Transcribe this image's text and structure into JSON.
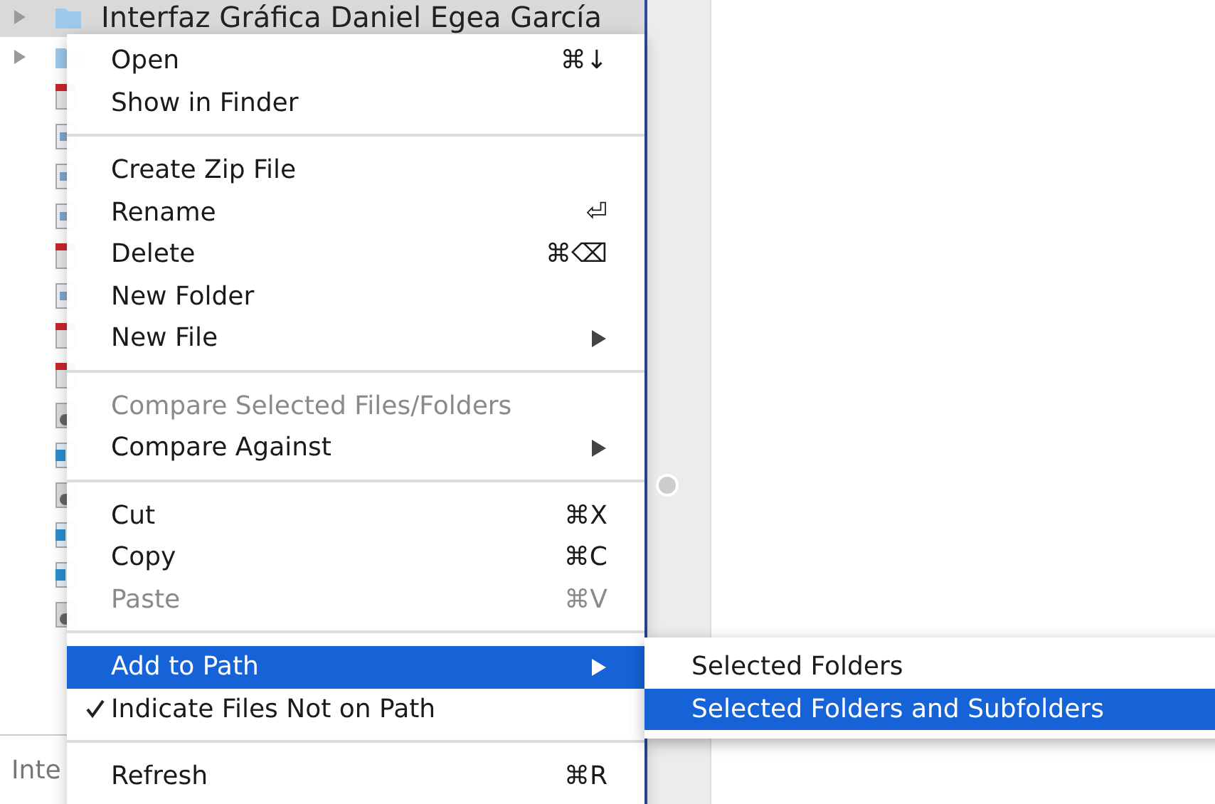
{
  "file_list": [
    {
      "kind": "folder",
      "name": "Interfaz Gráfica Daniel Egea García",
      "selected": true
    },
    {
      "kind": "folder",
      "selected": false
    },
    {
      "kind": "pdf",
      "selected": false
    },
    {
      "kind": "image",
      "selected": false
    },
    {
      "kind": "image",
      "selected": false
    },
    {
      "kind": "image",
      "selected": false
    },
    {
      "kind": "pdf",
      "selected": false
    },
    {
      "kind": "image",
      "selected": false
    },
    {
      "kind": "pdf",
      "selected": false
    },
    {
      "kind": "pdf",
      "selected": false
    },
    {
      "kind": "locked",
      "selected": false
    },
    {
      "kind": "word",
      "selected": false
    },
    {
      "kind": "locked",
      "selected": false
    },
    {
      "kind": "word",
      "selected": false
    },
    {
      "kind": "word",
      "selected": false
    },
    {
      "kind": "locked",
      "selected": false
    }
  ],
  "details_panel": {
    "title": "Inte"
  },
  "context_menu": [
    {
      "kind": "item",
      "label": "Open",
      "shortcut": "⌘↓",
      "submenu": false,
      "disabled": false,
      "checked": false,
      "selected": false
    },
    {
      "kind": "item",
      "label": "Show in Finder",
      "submenu": false,
      "disabled": false,
      "checked": false,
      "selected": false
    },
    {
      "kind": "separator"
    },
    {
      "kind": "item",
      "label": "Create Zip File",
      "submenu": false,
      "disabled": false,
      "checked": false,
      "selected": false
    },
    {
      "kind": "item",
      "label": "Rename",
      "shortcut": "⏎",
      "submenu": false,
      "disabled": false,
      "checked": false,
      "selected": false
    },
    {
      "kind": "item",
      "label": "Delete",
      "shortcut": "⌘⌫",
      "submenu": false,
      "disabled": false,
      "checked": false,
      "selected": false
    },
    {
      "kind": "item",
      "label": "New Folder",
      "submenu": false,
      "disabled": false,
      "checked": false,
      "selected": false
    },
    {
      "kind": "item",
      "label": "New File",
      "submenu": true,
      "disabled": false,
      "checked": false,
      "selected": false
    },
    {
      "kind": "separator"
    },
    {
      "kind": "item",
      "label": "Compare Selected Files/Folders",
      "submenu": false,
      "disabled": true,
      "checked": false,
      "selected": false
    },
    {
      "kind": "item",
      "label": "Compare Against",
      "submenu": true,
      "disabled": false,
      "checked": false,
      "selected": false
    },
    {
      "kind": "separator"
    },
    {
      "kind": "item",
      "label": "Cut",
      "shortcut": "⌘X",
      "submenu": false,
      "disabled": false,
      "checked": false,
      "selected": false
    },
    {
      "kind": "item",
      "label": "Copy",
      "shortcut": "⌘C",
      "submenu": false,
      "disabled": false,
      "checked": false,
      "selected": false
    },
    {
      "kind": "item",
      "label": "Paste",
      "shortcut": "⌘V",
      "submenu": false,
      "disabled": true,
      "checked": false,
      "selected": false
    },
    {
      "kind": "separator"
    },
    {
      "kind": "item",
      "label": "Add to Path",
      "submenu": true,
      "disabled": false,
      "checked": false,
      "selected": true
    },
    {
      "kind": "item",
      "label": "Indicate Files Not on Path",
      "submenu": false,
      "disabled": false,
      "checked": true,
      "selected": false
    },
    {
      "kind": "separator"
    },
    {
      "kind": "item",
      "label": "Refresh",
      "shortcut": "⌘R",
      "submenu": false,
      "disabled": false,
      "checked": false,
      "selected": false
    }
  ],
  "submenu": [
    {
      "label": "Selected Folders",
      "selected": false
    },
    {
      "label": "Selected Folders and Subfolders",
      "selected": true
    }
  ]
}
